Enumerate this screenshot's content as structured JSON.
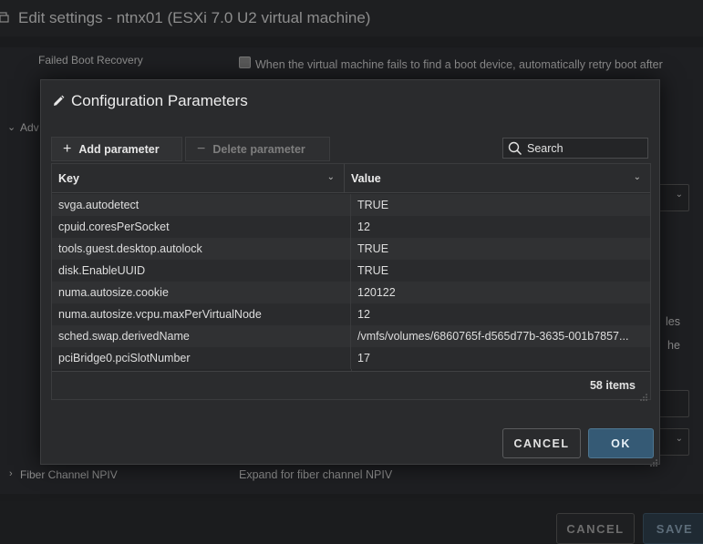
{
  "background": {
    "window_title": "Edit settings - ntnx01 (ESXi 7.0 U2 virtual machine)",
    "failed_boot_label": "Failed Boot Recovery",
    "failed_boot_text": "When the virtual machine fails to find a boot device, automatically retry boot after",
    "advanced_label": "Adv",
    "fiber_channel_label": "Fiber Channel NPIV",
    "fiber_channel_text": "Expand for fiber channel NPIV",
    "partial_right_1": "les",
    "partial_right_2": "he",
    "footer": {
      "cancel_label": "CANCEL",
      "save_label": "SAVE"
    }
  },
  "modal": {
    "title": "Configuration Parameters",
    "toolbar": {
      "add_label": "Add parameter",
      "delete_label": "Delete parameter"
    },
    "search": {
      "placeholder": "Search",
      "value": ""
    },
    "columns": {
      "key": "Key",
      "value": "Value"
    },
    "rows": [
      {
        "key": "svga.autodetect",
        "value": "TRUE"
      },
      {
        "key": "cpuid.coresPerSocket",
        "value": "12"
      },
      {
        "key": "tools.guest.desktop.autolock",
        "value": "TRUE"
      },
      {
        "key": "disk.EnableUUID",
        "value": "TRUE"
      },
      {
        "key": "numa.autosize.cookie",
        "value": "120122"
      },
      {
        "key": "numa.autosize.vcpu.maxPerVirtualNode",
        "value": "12"
      },
      {
        "key": "sched.swap.derivedName",
        "value": "/vmfs/volumes/6860765f-d565d77b-3635-001b7857..."
      },
      {
        "key": "pciBridge0.pciSlotNumber",
        "value": "17"
      }
    ],
    "item_count": "58 items",
    "cancel_label": "CANCEL",
    "ok_label": "OK"
  },
  "colors": {
    "ok_button": "#355a75",
    "modal_background": "#2a2b2d",
    "page_background": "#1b1c1e"
  }
}
